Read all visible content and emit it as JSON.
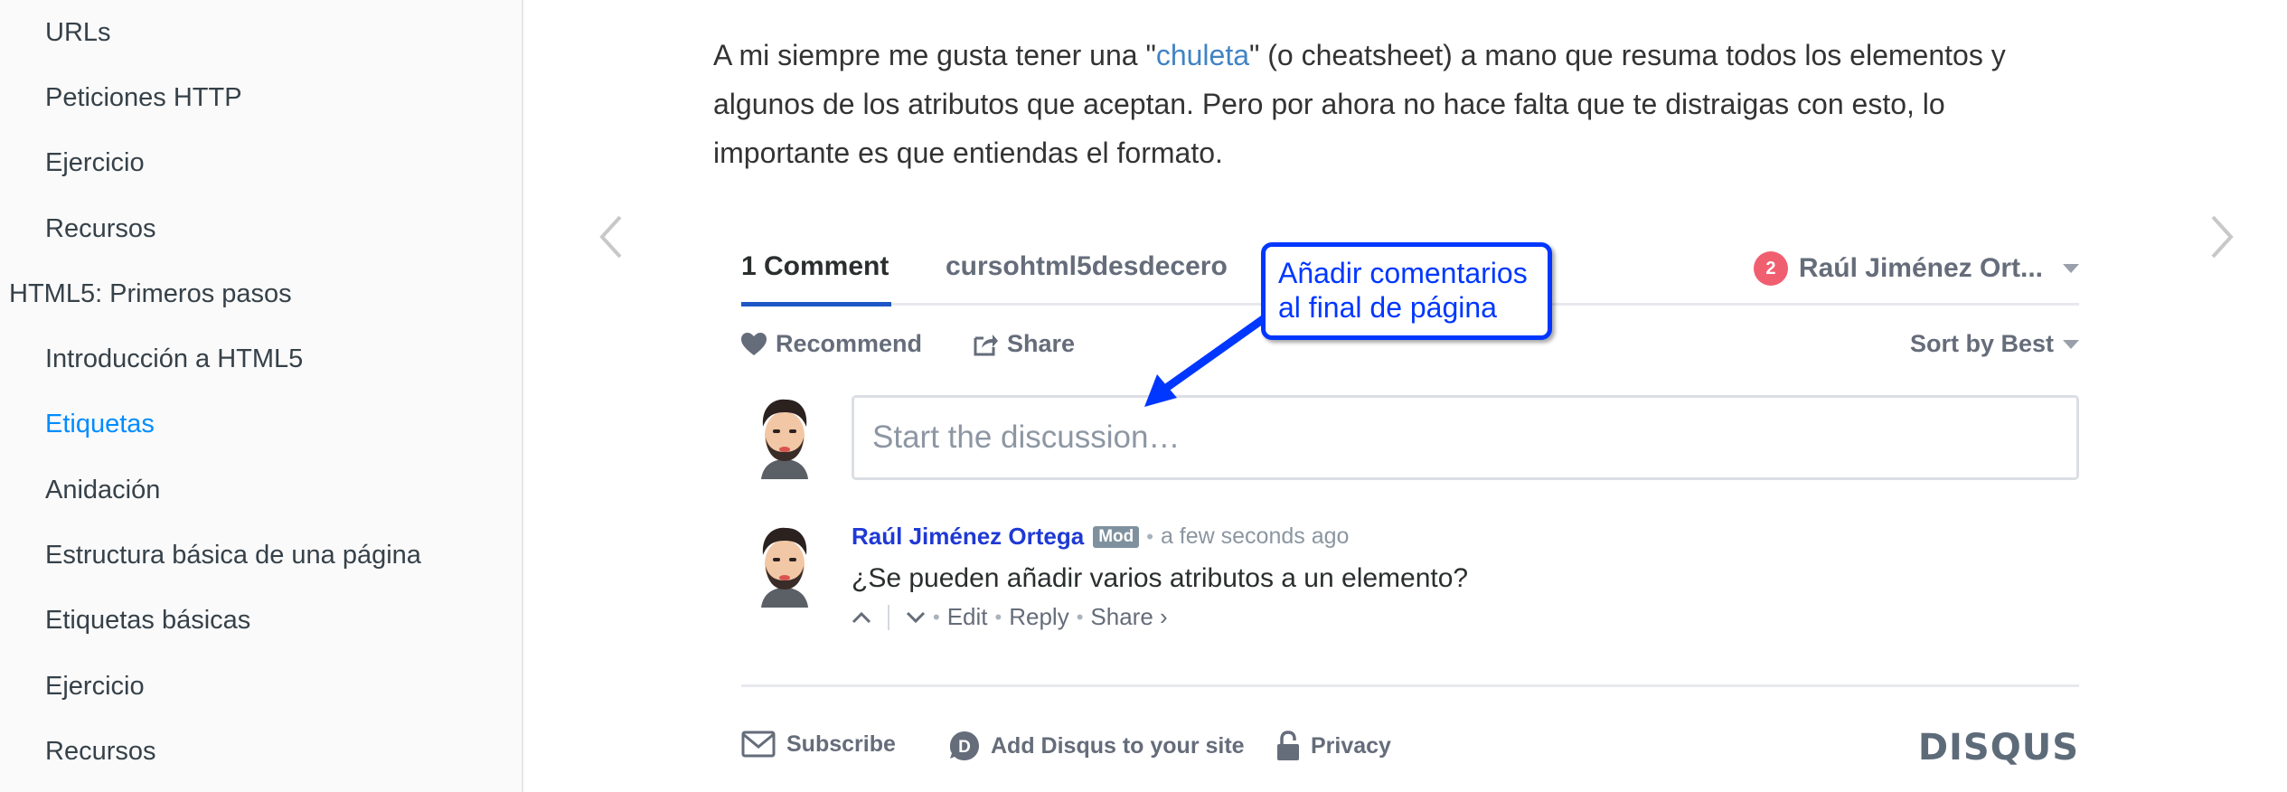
{
  "sidebar": {
    "items": [
      {
        "label": "URLs"
      },
      {
        "label": "Peticiones HTTP"
      },
      {
        "label": "Ejercicio"
      },
      {
        "label": "Recursos"
      },
      {
        "label": "HTML5: Primeros pasos"
      },
      {
        "label": "Introducción a HTML5"
      },
      {
        "label": "Etiquetas"
      },
      {
        "label": "Anidación"
      },
      {
        "label": "Estructura básica de una página"
      },
      {
        "label": "Etiquetas básicas"
      },
      {
        "label": "Ejercicio"
      },
      {
        "label": "Recursos"
      }
    ]
  },
  "article": {
    "text_before": "A mi siempre me gusta tener una \"",
    "link": "chuleta",
    "text_after": "\" (o cheatsheet) a mano que resuma todos los elementos y algunos de los atributos que aceptan. Pero por ahora no hace falta que te distraigas con esto, lo importante es que entiendas el formato."
  },
  "disqus": {
    "tab_comments": "1 Comment",
    "tab_forum": "cursohtml5desdecero",
    "notification_count": "2",
    "user_name": "Raúl Jiménez Ort...",
    "recommend": "Recommend",
    "share": "Share",
    "sort": "Sort by Best",
    "input_placeholder": "Start the discussion…",
    "comment": {
      "author": "Raúl Jiménez Ortega",
      "badge": "Mod",
      "time": "a few seconds ago",
      "body": "¿Se pueden añadir varios atributos a un elemento?",
      "edit": "Edit",
      "reply": "Reply",
      "share": "Share ›"
    },
    "footer": {
      "subscribe": "Subscribe",
      "add_disqus": "Add Disqus to your site",
      "privacy": "Privacy",
      "logo": "DISQUS"
    }
  },
  "annotation": {
    "text": "Añadir comentarios al final de página",
    "color": "#0037ff"
  },
  "colors": {
    "accent": "#008cff",
    "link": "#4183c4",
    "author": "#1f39d4",
    "badge": "#f05f70"
  }
}
